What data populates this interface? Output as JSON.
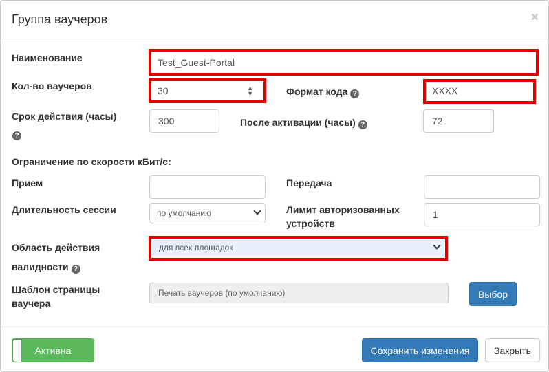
{
  "header": {
    "title": "Группа ваучеров",
    "close_label": "×"
  },
  "form": {
    "name": {
      "label": "Наименование",
      "value": "Test_Guest-Portal"
    },
    "count": {
      "label": "Кол-во ваучеров",
      "value": "30"
    },
    "code_format": {
      "label": "Формат кода",
      "value": "XXXX"
    },
    "validity": {
      "label": "Срок действия (часы)",
      "value": "300"
    },
    "after_activation": {
      "label": "После активации (часы)",
      "value": "72"
    },
    "speed_limit": {
      "label": "Ограничение по скорости кБит/с:"
    },
    "receive": {
      "label": "Прием",
      "value": ""
    },
    "transmit": {
      "label": "Передача",
      "value": ""
    },
    "session_duration": {
      "label": "Длительность сессии",
      "selected": "по умолчанию"
    },
    "device_limit": {
      "label_line1": "Лимит авторизованных",
      "label_line2": "устройств",
      "value": "1"
    },
    "scope": {
      "label_line1": "Область действия",
      "label_line2": "валидности",
      "selected": "для всех площадок"
    },
    "template": {
      "label_line1": "Шаблон страницы",
      "label_line2": "ваучера",
      "value": "Печать ваучеров (по умолчанию)",
      "choose_label": "Выбор"
    }
  },
  "footer": {
    "active_label": "Активна",
    "save_label": "Сохранить изменения",
    "close_label": "Закрыть"
  },
  "colors": {
    "highlight": "#e00000",
    "primary": "#337ab7",
    "success": "#5cb85c"
  }
}
